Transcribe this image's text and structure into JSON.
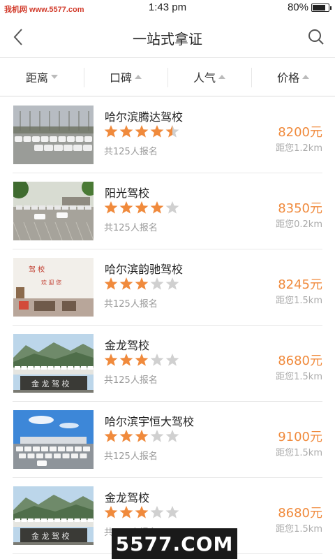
{
  "status_bar": {
    "left_text": "我机网 www.5577.com",
    "time": "1:43 pm",
    "battery": "80%",
    "battery_level": 0.8
  },
  "header": {
    "title": "一站式拿证",
    "back_icon": "chevron-left-icon",
    "search_icon": "search-icon"
  },
  "filters": [
    {
      "label": "距离",
      "arrow": "down"
    },
    {
      "label": "口碑",
      "arrow": "up"
    },
    {
      "label": "人气",
      "arrow": "up"
    },
    {
      "label": "价格",
      "arrow": "up"
    }
  ],
  "accent_color": "#f08a3c",
  "star_color": "#f08a3c",
  "star_empty_color": "#d0d0d0",
  "schools": [
    {
      "name": "哈尔滨腾达驾校",
      "rating": 4.5,
      "signup": "共125人报名",
      "price": "8200元",
      "distance": "距您1.2km",
      "thumb": "parking-lot"
    },
    {
      "name": "阳光驾校",
      "rating": 4,
      "signup": "共125人报名",
      "price": "8350元",
      "distance": "距您0.2km",
      "thumb": "training-yard"
    },
    {
      "name": "哈尔滨韵驰驾校",
      "rating": 3,
      "signup": "共125人报名",
      "price": "8245元",
      "distance": "距您1.5km",
      "thumb": "classroom"
    },
    {
      "name": "金龙驾校",
      "rating": 3,
      "signup": "共125人报名",
      "price": "8680元",
      "distance": "距您1.5km",
      "thumb": "mountain-gate"
    },
    {
      "name": "哈尔滨宇恒大驾校",
      "rating": 3,
      "signup": "共125人报名",
      "price": "9100元",
      "distance": "距您1.5km",
      "thumb": "blue-sky-lot"
    },
    {
      "name": "金龙驾校",
      "rating": 3,
      "signup": "共125人报名",
      "price": "8680元",
      "distance": "距您1.5km",
      "thumb": "mountain-gate"
    }
  ],
  "thumb_labels": {
    "classroom_banner": "驾校 欢迎您",
    "mountain_sign": "金龙驾校"
  },
  "watermark": "5577.COM"
}
